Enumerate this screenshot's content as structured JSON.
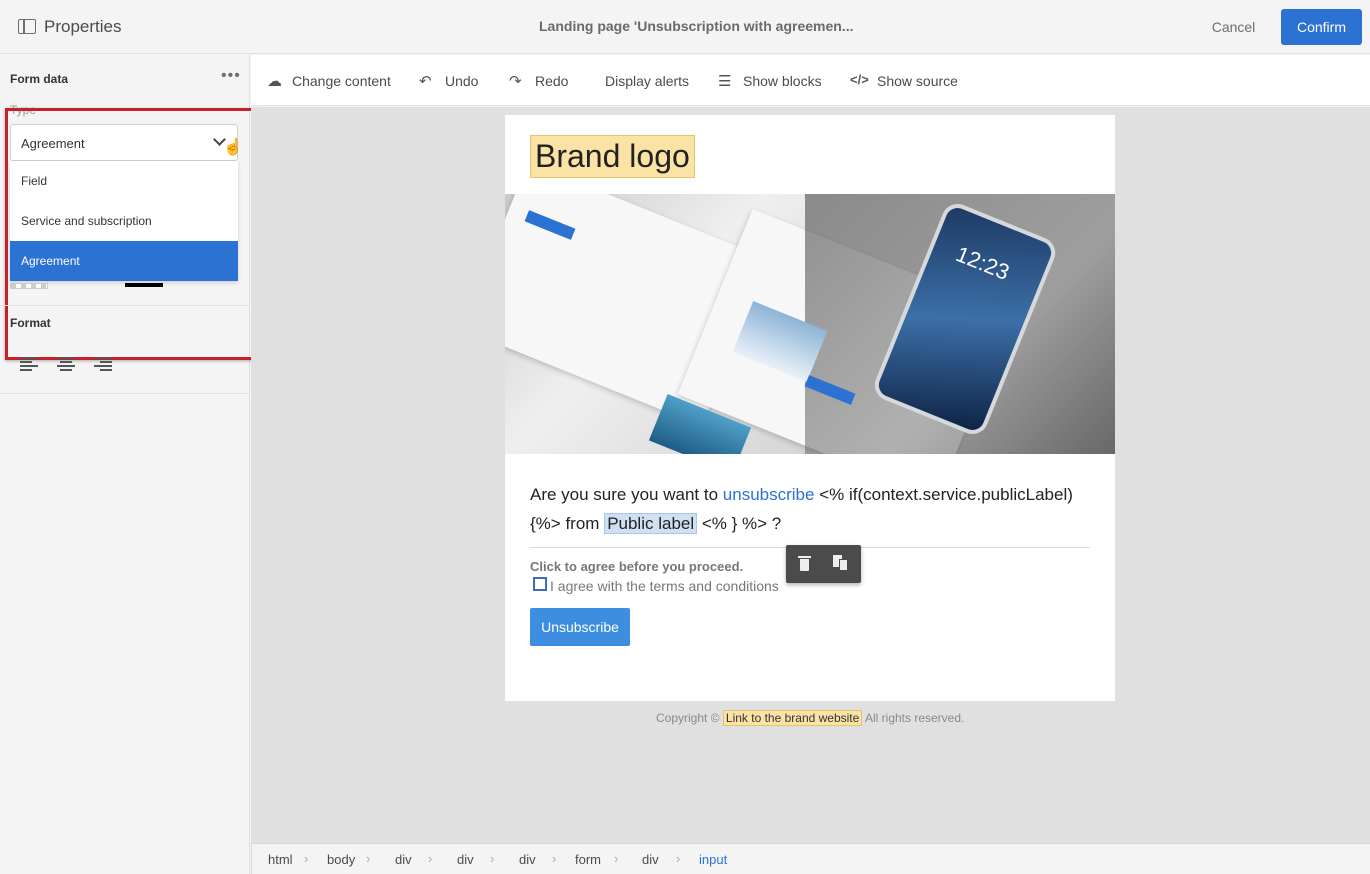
{
  "header": {
    "panel_title": "Properties",
    "page_title": "Landing page 'Unsubscription with agreemen...",
    "cancel_label": "Cancel",
    "confirm_label": "Confirm"
  },
  "left_panel": {
    "form_data_title": "Form data",
    "type_label": "Type",
    "selected_type": "Agreement",
    "type_options": [
      "Field",
      "Service and subscription",
      "Agreement"
    ],
    "format_title": "Format"
  },
  "toolbar": {
    "items": [
      "Change content",
      "Undo",
      "Redo",
      "Display alerts",
      "Show blocks",
      "Show source"
    ]
  },
  "email": {
    "brand_logo": "Brand logo",
    "hero_phone_time": "12:23",
    "question_prefix": "Are you sure you want to",
    "question_link": "unsubscribe",
    "question_mid": "<% if(context.service.publicLabel) {%> from",
    "question_label": "Public label",
    "question_suffix": "<% } %> ?",
    "agree_title": "Click to agree before you proceed.",
    "agree_text": "I agree with the terms and conditions",
    "unsubscribe_label": "Unsubscribe",
    "footer_prefix": "Copyright ©",
    "footer_link": "Link to the brand website",
    "footer_suffix": "All rights reserved."
  },
  "breadcrumb": [
    "html",
    "body",
    "div",
    "div",
    "div",
    "form",
    "div",
    "input"
  ],
  "colors": {
    "accent": "#2c72d3",
    "highlight_red": "#c8202a",
    "brand_highlight": "#fbe3a6"
  }
}
